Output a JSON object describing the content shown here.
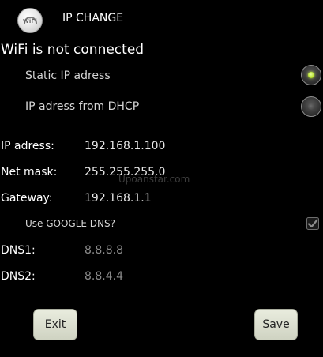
{
  "header": {
    "app_icon": "wifi-logo-icon",
    "app_icon_text": "WiFi",
    "title": "IP CHANGE"
  },
  "status": {
    "text": "WiFi is not connected"
  },
  "ip_mode": {
    "static_label": "Static IP adress",
    "dhcp_label": "IP adress from DHCP",
    "selected": "static",
    "accent_color": "#b8e32c"
  },
  "fields": {
    "ip_label": "IP adress:",
    "ip_value": "192.168.1.100",
    "mask_label": "Net mask:",
    "mask_value": "255.255.255.0",
    "gateway_label": "Gateway:",
    "gateway_value": "192.168.1.1"
  },
  "watermark": "Upoanstar.com",
  "google_dns": {
    "label": "Use GOOGLE DNS?",
    "checked": true
  },
  "dns": {
    "dns1_label": "DNS1:",
    "dns1_value": "8.8.8.8",
    "dns2_label": "DNS2:",
    "dns2_value": "8.8.4.4"
  },
  "buttons": {
    "exit_label": "Exit",
    "save_label": "Save"
  }
}
